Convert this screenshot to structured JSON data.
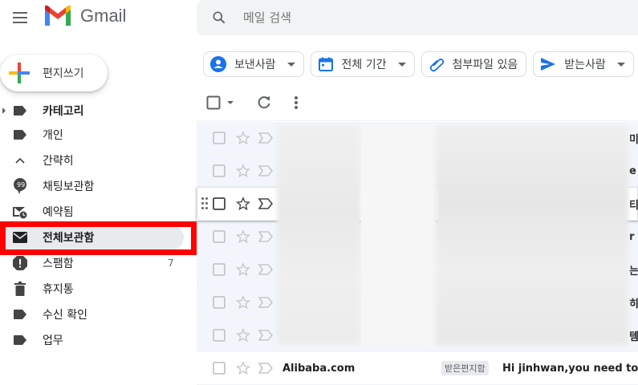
{
  "app": {
    "name": "Gmail"
  },
  "search": {
    "placeholder": "메일 검색"
  },
  "compose": {
    "label": "편지쓰기"
  },
  "nav": {
    "items": [
      {
        "id": "categories",
        "label": "카테고리",
        "icon": "label-icon",
        "bold": true,
        "expand": true
      },
      {
        "id": "personal",
        "label": "개인",
        "icon": "label-icon"
      },
      {
        "id": "less",
        "label": "간략히",
        "icon": "chevron-up-icon"
      },
      {
        "id": "chats",
        "label": "채팅보관함",
        "icon": "chat-icon"
      },
      {
        "id": "scheduled",
        "label": "예약됨",
        "icon": "scheduled-icon"
      },
      {
        "id": "all-mail",
        "label": "전체보관함",
        "icon": "mail-icon",
        "selected": true
      },
      {
        "id": "spam",
        "label": "스팸함",
        "icon": "spam-icon",
        "count": "7"
      },
      {
        "id": "trash",
        "label": "휴지통",
        "icon": "trash-icon"
      },
      {
        "id": "read-receipt",
        "label": "수신 확인",
        "icon": "label-icon"
      },
      {
        "id": "work",
        "label": "업무",
        "icon": "label-icon"
      }
    ]
  },
  "filters": {
    "from": "보낸사람",
    "date": "전체 기간",
    "attachment": "첨부파일 있음",
    "to": "받는사람"
  },
  "messages": {
    "last_row": {
      "sender": "Alibaba.com",
      "tag": "받은편지함",
      "subject": "Hi jinhwan,you need to see"
    },
    "edge_text": [
      "미",
      "e",
      "티",
      "r",
      "는",
      "히",
      "템"
    ]
  },
  "colors": {
    "highlight": "#ff0000",
    "accent_blue": "#1a73e8"
  }
}
